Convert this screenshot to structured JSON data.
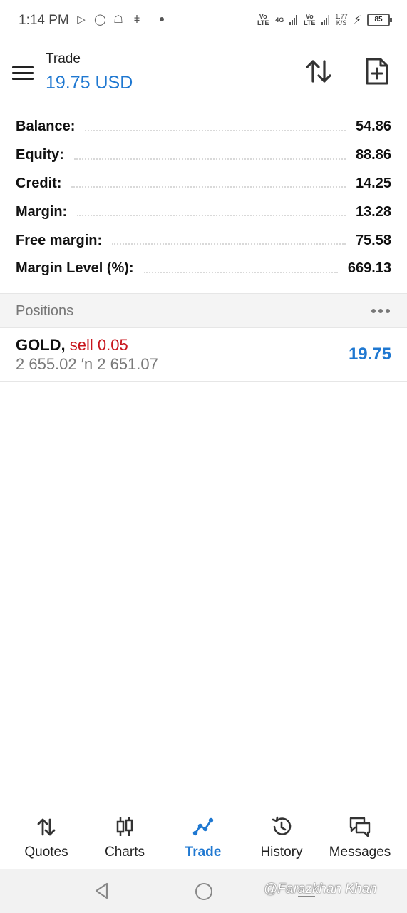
{
  "status_bar": {
    "time": "1:14 PM",
    "left_icons": [
      "screen-cast-icon",
      "whatsapp-icon",
      "snapchat-icon",
      "notification-icon"
    ],
    "network_1": "Vo LTE",
    "network_2": "4G",
    "network_3": "Vo LTE",
    "speed_value": "1.77",
    "speed_unit": "K/S",
    "battery": "85"
  },
  "header": {
    "title": "Trade",
    "balance_display": "19.75 USD"
  },
  "account": [
    {
      "label": "Balance:",
      "value": "54.86"
    },
    {
      "label": "Equity:",
      "value": "88.86"
    },
    {
      "label": "Credit:",
      "value": "14.25"
    },
    {
      "label": "Margin:",
      "value": "13.28"
    },
    {
      "label": "Free margin:",
      "value": "75.58"
    },
    {
      "label": "Margin Level (%):",
      "value": "669.13"
    }
  ],
  "positions": {
    "title": "Positions",
    "items": [
      {
        "symbol": "GOLD,",
        "side": "sell 0.05",
        "prices": "2 655.02 ′n  2 651.07",
        "profit": "19.75"
      }
    ]
  },
  "bottom_nav": {
    "items": [
      {
        "label": "Quotes",
        "icon": "quotes-icon"
      },
      {
        "label": "Charts",
        "icon": "charts-icon"
      },
      {
        "label": "Trade",
        "icon": "trade-icon",
        "active": true
      },
      {
        "label": "History",
        "icon": "history-icon"
      },
      {
        "label": "Messages",
        "icon": "messages-icon"
      }
    ]
  },
  "watermark": "@Farazkhan Khan",
  "colors": {
    "accent": "#1f78d1",
    "sell": "#c8161d",
    "muted": "#7a7a7a"
  }
}
